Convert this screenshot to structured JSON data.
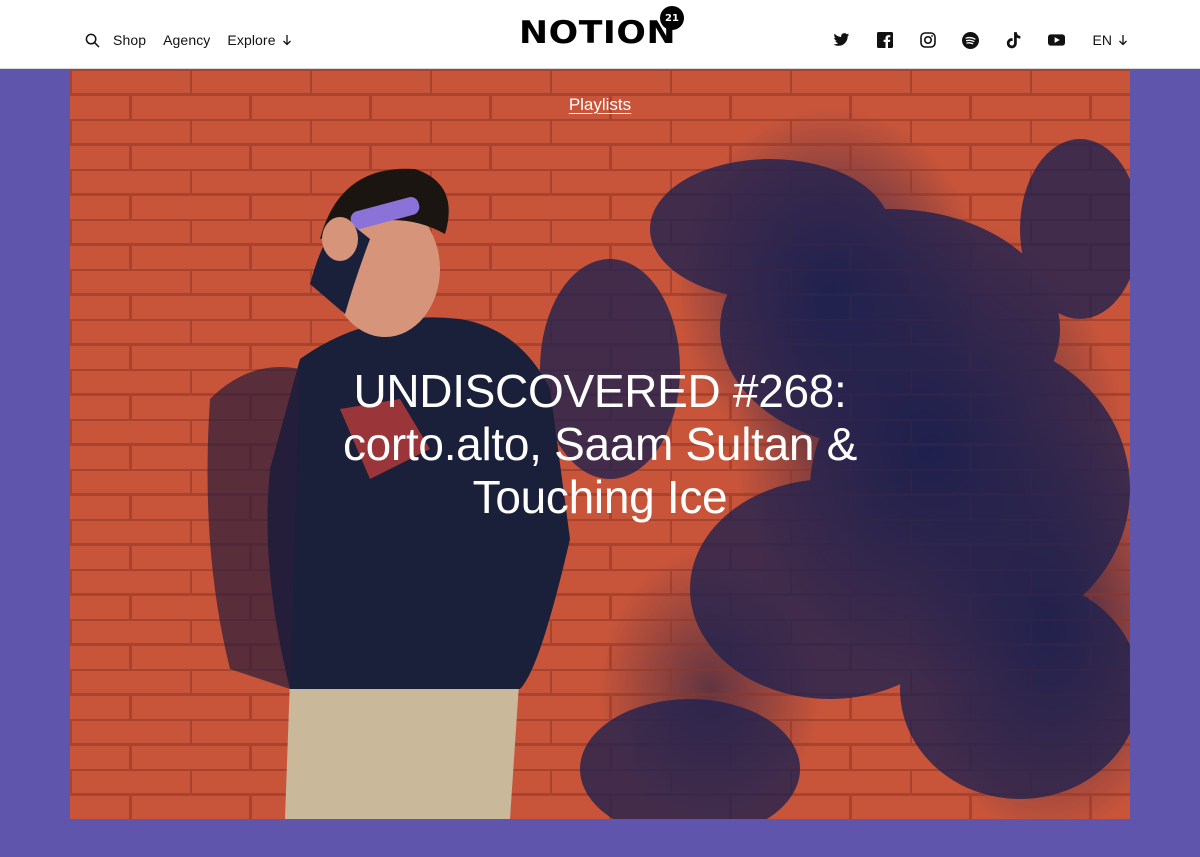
{
  "header": {
    "nav": {
      "search_icon": "search-icon",
      "shop_label": "Shop",
      "agency_label": "Agency",
      "explore_label": "Explore"
    },
    "logo": {
      "word": "NOTION",
      "badge": "21"
    },
    "social": [
      "twitter-icon",
      "facebook-icon",
      "instagram-icon",
      "spotify-icon",
      "tiktok-icon",
      "youtube-icon"
    ],
    "language_label": "EN"
  },
  "hero": {
    "category_label": "Playlists",
    "title": "UNDISCOVERED #268: corto.alto, Saam Sultan & Touching Ice"
  },
  "colors": {
    "page_background": "#5f55ad",
    "brick": "#c8553a",
    "shadow": "#1c1f4a",
    "text_on_image": "#ffffff"
  }
}
